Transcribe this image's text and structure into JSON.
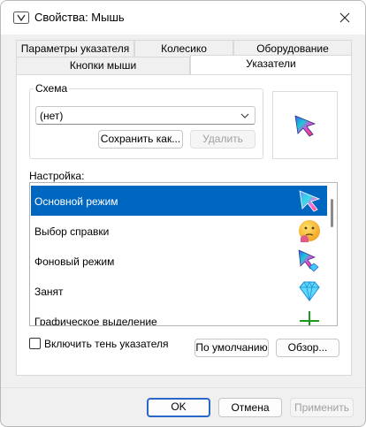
{
  "window": {
    "title": "Свойства: Мышь"
  },
  "tabs": {
    "row1": [
      "Параметры указателя",
      "Колесико",
      "Оборудование"
    ],
    "row2": [
      "Кнопки мыши",
      "Указатели"
    ],
    "active": "Указатели"
  },
  "scheme": {
    "legend": "Схема",
    "selected": "(нет)",
    "save_label": "Сохранить как...",
    "delete_label": "Удалить"
  },
  "settings": {
    "label": "Настройка:",
    "items": [
      {
        "label": "Основной режим",
        "icon": "rainbow-arrow-icon",
        "selected": true
      },
      {
        "label": "Выбор справки",
        "icon": "thinking-emoji-icon",
        "selected": false
      },
      {
        "label": "Фоновый режим",
        "icon": "rainbow-arrow-busy-icon",
        "selected": false
      },
      {
        "label": "Занят",
        "icon": "diamond-icon",
        "selected": false
      },
      {
        "label": "Графическое выделение",
        "icon": "crosshair-icon",
        "selected": false
      }
    ]
  },
  "shadow_checkbox": {
    "label": "Включить тень указателя",
    "checked": false
  },
  "buttons": {
    "default_label": "По умолчанию",
    "browse_label": "Обзор...",
    "ok_label": "OK",
    "cancel_label": "Отмена",
    "apply_label": "Применить"
  },
  "colors": {
    "selection": "#0067c0",
    "accent_border": "#2a68c8"
  }
}
